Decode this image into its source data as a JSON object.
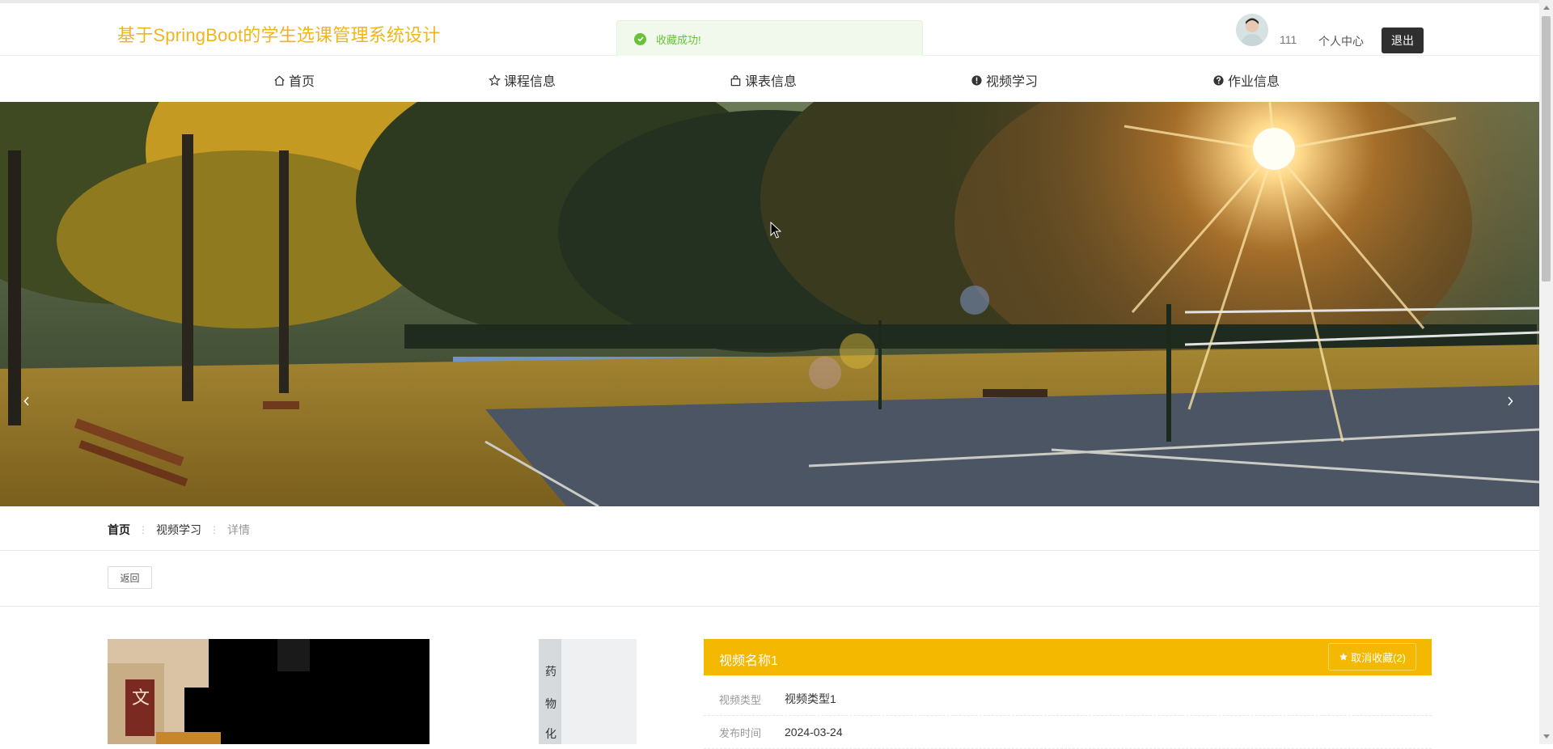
{
  "header": {
    "site_title": "基于SpringBoot的学生选课管理系统设计",
    "username": "111",
    "personal_center": "个人中心",
    "logout": "退出"
  },
  "toast": {
    "message": "收藏成功!"
  },
  "nav": [
    {
      "label": "首页",
      "icon": "home-icon"
    },
    {
      "label": "课程信息",
      "icon": "star-icon"
    },
    {
      "label": "课表信息",
      "icon": "bag-icon"
    },
    {
      "label": "视频学习",
      "icon": "alert-circle-icon"
    },
    {
      "label": "作业信息",
      "icon": "question-circle-icon"
    }
  ],
  "carousel": {
    "slide_count": 3,
    "active_index": 1
  },
  "breadcrumb": {
    "home": "首页",
    "section": "视频学习",
    "current": "详情"
  },
  "back_button": "返回",
  "detail": {
    "title": "视频名称1",
    "favorite_button": "取消收藏(2)",
    "rows": [
      {
        "label": "视频类型",
        "value": "视频类型1"
      },
      {
        "label": "发布时间",
        "value": "2024-03-24"
      }
    ]
  },
  "colors": {
    "accent": "#f5b800",
    "title": "#f1b51c",
    "success": "#67c23a"
  }
}
